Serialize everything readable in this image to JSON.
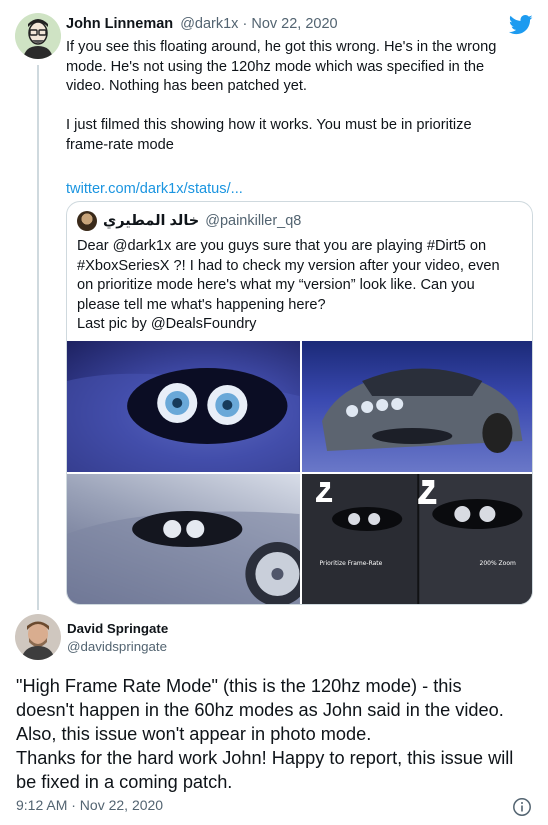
{
  "tweet1": {
    "name": "John Linneman",
    "handle": "@dark1x",
    "separator": "·",
    "date": "Nov 22, 2020",
    "lines": [
      "If you see this floating around, he got this wrong. He's in the wrong",
      "mode. He's not using the 120hz mode which was specified in the",
      "video. Nothing has been patched yet.",
      "I just filmed this showing how it works. You must be in prioritize",
      "frame-rate mode"
    ],
    "link": "twitter.com/dark1x/status/..."
  },
  "quote": {
    "name": "خالد المطيري",
    "handle": "@painkiller_q8",
    "lines": [
      "Dear @dark1x are you guys sure that you are playing #Dirt5 on",
      "#XboxSeriesX ?! I had to check my version after your video, even",
      "on prioritize mode here's what my “version” look like. Can you",
      "please tell me what's happening here?",
      "Last pic by @DealsFoundry"
    ],
    "photo4_labels": {
      "left": "Prioritize Frame-Rate",
      "right": "200% Zoom"
    }
  },
  "tweet2": {
    "name": "David Springate",
    "handle": "@davidspringate",
    "lines": [
      "\"High Frame Rate Mode\" (this is the 120hz mode) - this",
      "doesn't happen in the 60hz modes as John said in the video.",
      "Also, this issue won't appear in photo mode.",
      "Thanks for the hard work John! Happy to report, this issue will",
      "be fixed in a coming patch."
    ],
    "timestamp": "9:12 AM · Nov 22, 2020"
  },
  "colors": {
    "brand": "#1d9bf0",
    "link": "#1b95e0",
    "muted": "#536471"
  },
  "icons": [
    "twitter-bird-icon",
    "info-icon"
  ]
}
